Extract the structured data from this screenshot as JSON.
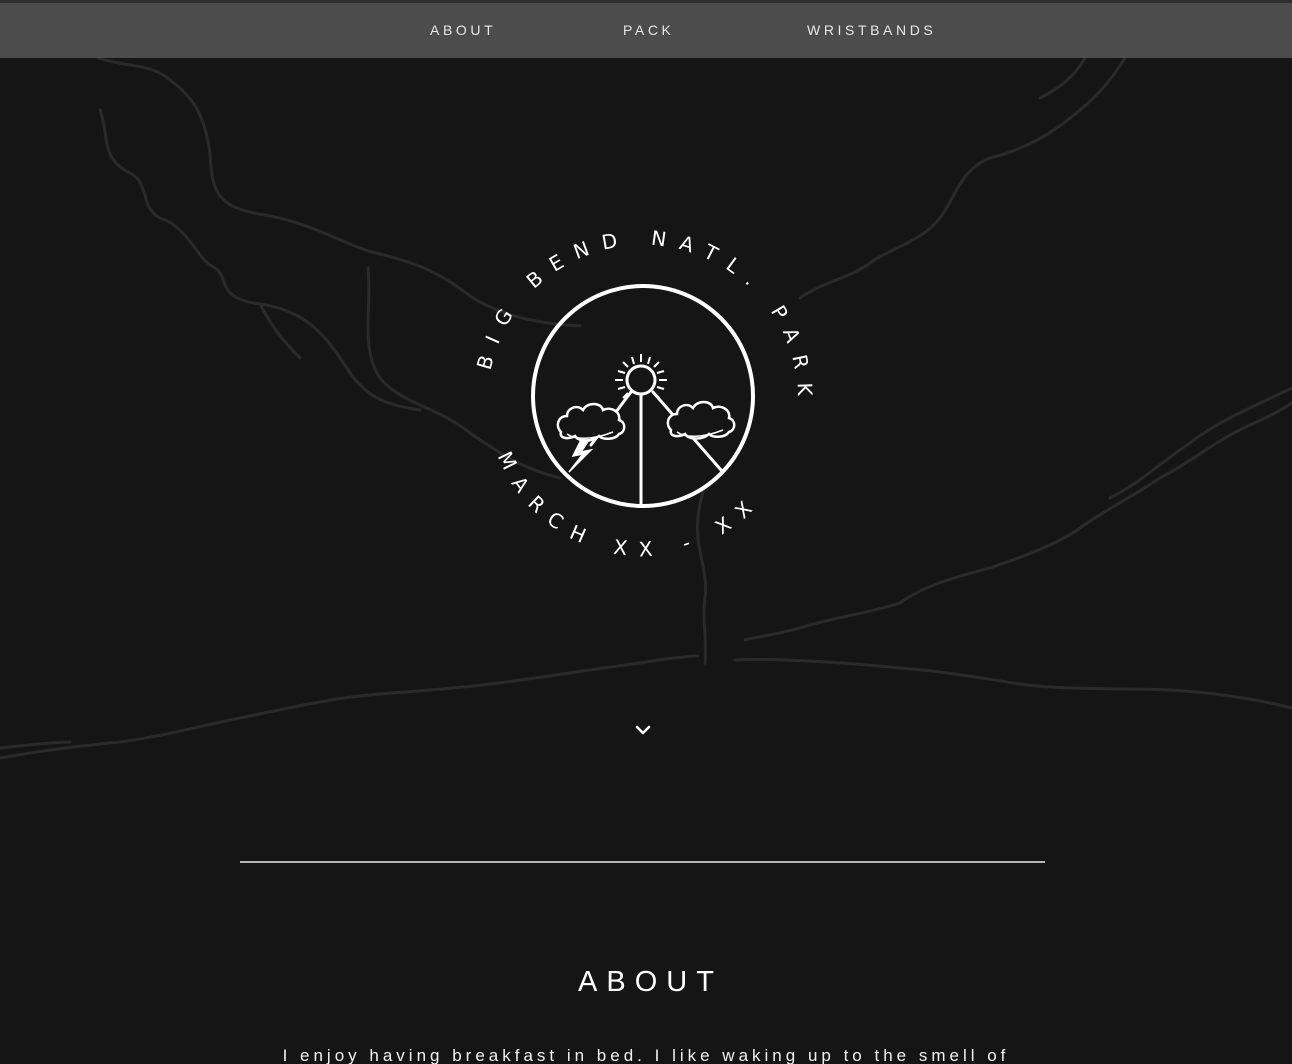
{
  "nav": {
    "items": [
      {
        "label": "ABOUT"
      },
      {
        "label": "PACK"
      },
      {
        "label": "WRISTBANDS"
      }
    ]
  },
  "hero": {
    "badge": {
      "top_text": "BIG BEND NATL. PARK",
      "bottom_text": "MARCH XX - XX"
    },
    "scroll_icon": "chevron-down-icon"
  },
  "about": {
    "title": "ABOUT",
    "body": "I enjoy having breakfast in bed. I like waking up to the smell of"
  },
  "colors": {
    "background": "#151515",
    "navbar": "#4c4c4c",
    "river_lines": "#2a2a2a",
    "text": "#ffffff"
  }
}
